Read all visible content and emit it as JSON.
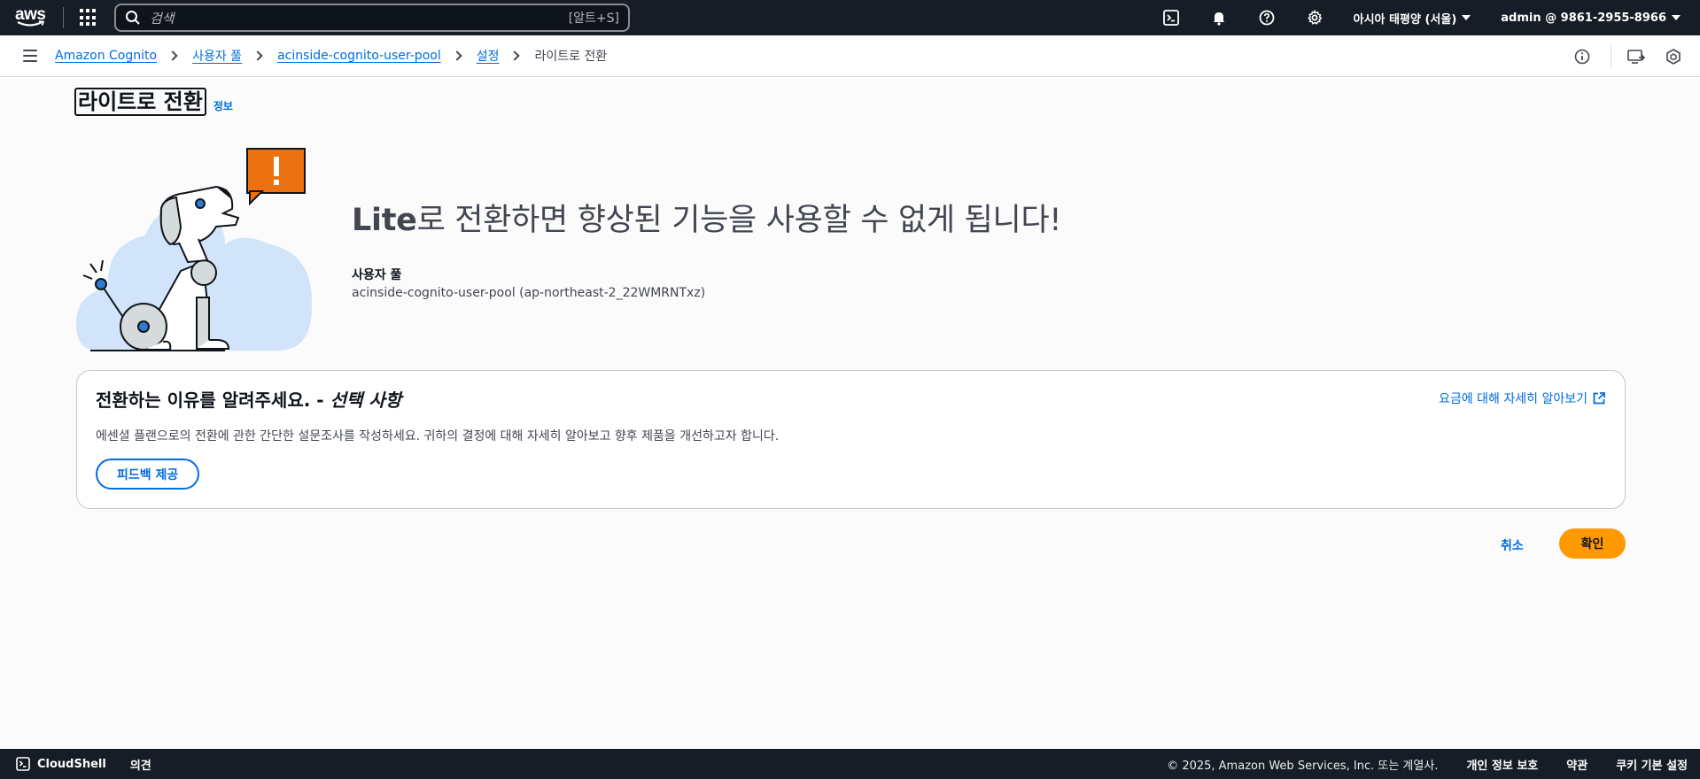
{
  "topnav": {
    "logo_text": "aws",
    "search_placeholder": "검색",
    "search_shortcut": "[알트+S]",
    "region": "아시아 태평양 (서울)",
    "account": "admin @ 9861-2955-8966"
  },
  "breadcrumb": {
    "items": [
      "Amazon Cognito",
      "사용자 풀",
      "acinside-cognito-user-pool",
      "설정"
    ],
    "current": "라이트로 전환"
  },
  "page": {
    "title": "라이트로 전환",
    "info_label": "정보"
  },
  "hero": {
    "headline_bold": "Lite",
    "headline_rest": "로 전환하면 향상된 기능을 사용할 수 없게 됩니다!",
    "user_pool_label": "사용자 풀",
    "user_pool_value": "acinside-cognito-user-pool (ap-northeast-2_22WMRNTxz)"
  },
  "feedback_card": {
    "title": "전환하는 이유를 알려주세요. - ",
    "title_optional": "선택 사항",
    "pricing_link": "요금에 대해 자세히 알아보기",
    "description": "에센셜 플랜으로의 전환에 관한 간단한 설문조사를 작성하세요. 귀하의 결정에 대해 자세히 알아보고 향후 제품을 개선하고자 합니다.",
    "feedback_button": "피드백 제공"
  },
  "actions": {
    "cancel": "취소",
    "confirm": "확인"
  },
  "footer": {
    "cloudshell": "CloudShell",
    "feedback": "의견",
    "copyright": "© 2025, Amazon Web Services, Inc. 또는 계열사.",
    "privacy": "개인 정보 보호",
    "terms": "약관",
    "cookies": "쿠키 기본 설정"
  },
  "colors": {
    "nav_bg": "#161d26",
    "link": "#006ce0",
    "primary_button": "#ff9900",
    "alert_orange": "#ec7211"
  }
}
